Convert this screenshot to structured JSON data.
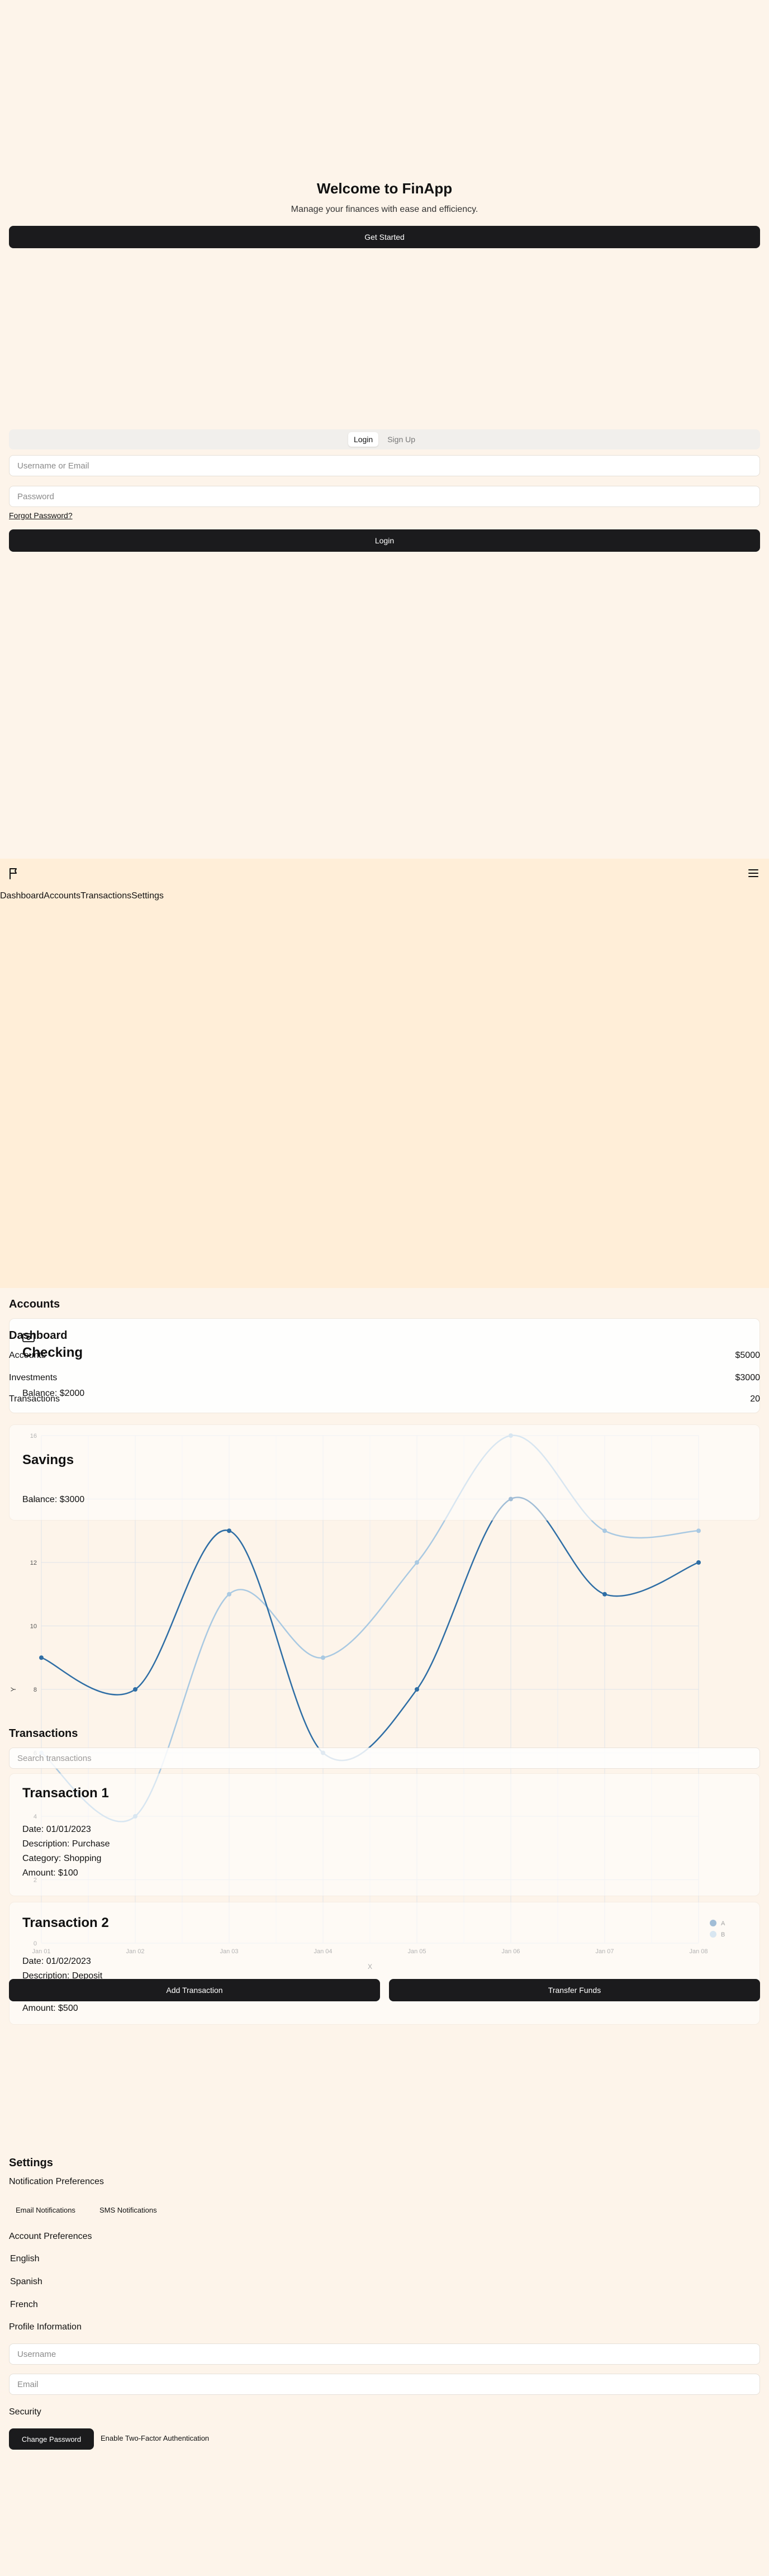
{
  "hero": {
    "title": "Welcome to FinApp",
    "subtitle": "Manage your finances with ease and efficiency.",
    "cta": "Get Started"
  },
  "auth": {
    "tabs": [
      "Login",
      "Sign Up"
    ],
    "active_tab": "Login",
    "username_placeholder": "Username or Email",
    "password_placeholder": "Password",
    "forgot": "Forgot Password?",
    "submit": "Login"
  },
  "nav": {
    "items": [
      "Dashboard",
      "Accounts",
      "Transactions",
      "Settings"
    ]
  },
  "dashboard": {
    "title": "Dashboard",
    "rows": [
      {
        "label": "Accounts",
        "value": "$5000"
      },
      {
        "label": "Investments",
        "value": "$3000"
      },
      {
        "label": "Transactions",
        "value": "20"
      }
    ]
  },
  "accounts": {
    "title": "Accounts",
    "items": [
      {
        "name": "Checking",
        "balance": "Balance: $2000"
      },
      {
        "name": "Savings",
        "balance": "Balance: $3000"
      }
    ]
  },
  "transactions": {
    "title": "Transactions",
    "search_placeholder": "Search transactions",
    "items": [
      {
        "title": "Transaction 1",
        "date": "Date: 01/01/2023",
        "description": "Description: Purchase",
        "category": "Category: Shopping",
        "amount": "Amount: $100"
      },
      {
        "title": "Transaction 2",
        "date": "Date: 01/02/2023",
        "description": "Description: Deposit",
        "amount": "Amount: $500"
      }
    ],
    "add_button": "Add Transaction",
    "transfer_button": "Transfer Funds"
  },
  "chart_data": {
    "type": "line",
    "x": [
      "Jan 01",
      "Jan 02",
      "Jan 03",
      "Jan 04",
      "Jan 05",
      "Jan 06",
      "Jan 07",
      "Jan 08"
    ],
    "series": [
      {
        "name": "A",
        "values": [
          9,
          8,
          13,
          6,
          8,
          14,
          11,
          12
        ],
        "color": "#2f6ea5"
      },
      {
        "name": "B",
        "values": [
          6,
          4,
          11,
          9,
          12,
          16,
          13,
          13
        ],
        "color": "#a9c9e2"
      }
    ],
    "xlabel": "X",
    "ylabel": "Y",
    "ylim": [
      0,
      16
    ],
    "yticks": [
      0,
      2,
      4,
      6,
      8,
      10,
      12,
      14,
      16
    ],
    "grid": true,
    "legend": "bottom-right"
  },
  "settings": {
    "title": "Settings",
    "notification_title": "Notification Preferences",
    "email_notifications": "Email Notifications",
    "sms_notifications": "SMS Notifications",
    "account_prefs_title": "Account Preferences",
    "languages": [
      "English",
      "Spanish",
      "French"
    ],
    "profile_title": "Profile Information",
    "username_placeholder": "Username",
    "email_placeholder": "Email",
    "security_title": "Security",
    "change_password": "Change Password",
    "two_factor": "Enable Two-Factor Authentication"
  },
  "colors": {
    "background": "#fdf4ea",
    "hero_band": "#ffeed8",
    "dark": "#1b1b1d",
    "series_a": "#2f6ea5",
    "series_b": "#a9c9e2"
  }
}
